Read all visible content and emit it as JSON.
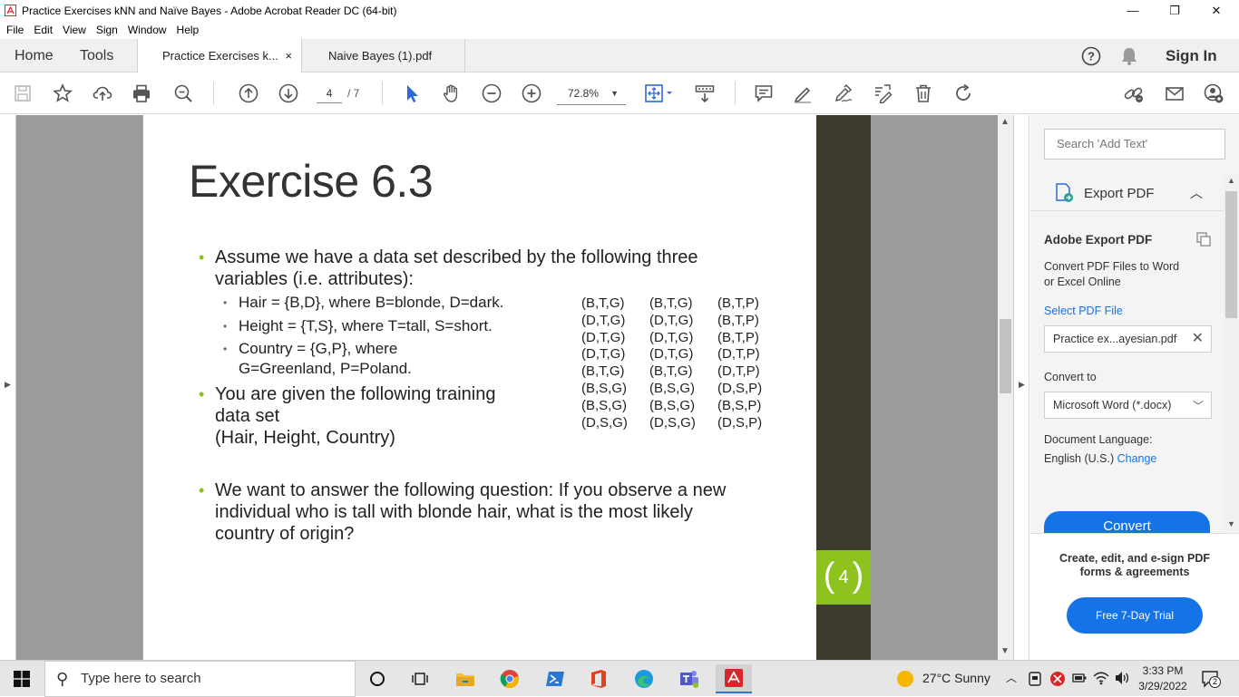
{
  "window": {
    "title": "Practice Exercises kNN and Naïve Bayes - Adobe Acrobat Reader DC (64-bit)",
    "minimize": "—",
    "restore": "❐",
    "close": "✕"
  },
  "menu": [
    "File",
    "Edit",
    "View",
    "Sign",
    "Window",
    "Help"
  ],
  "tabs": {
    "home": "Home",
    "tools": "Tools",
    "documents": [
      {
        "label": "Practice Exercises k...",
        "close": "×",
        "active": true
      },
      {
        "label": "Naive Bayes (1).pdf",
        "active": false
      }
    ],
    "help_icon": "?",
    "sign_in": "Sign In"
  },
  "toolbar": {
    "page_current": "4",
    "page_total": "/ 7",
    "zoom": "72.8%"
  },
  "slide": {
    "title": "Exercise 6.3",
    "bullet1": [
      "Assume we have a data set described by the following three",
      "variables (i.e. attributes):"
    ],
    "sub": [
      "Hair = {B,D}, where B=blonde, D=dark.",
      "Height = {T,S}, where T=tall, S=short.",
      "Country = {G,P}, where",
      "G=Greenland, P=Poland."
    ],
    "bullet2": [
      "You are given the following training",
      "data set",
      "(Hair, Height, Country)"
    ],
    "bullet3": [
      "We want to answer the following question: If you observe a new",
      "individual who is tall with blonde hair, what is the most likely",
      "country of origin?"
    ],
    "table": [
      [
        "(B,T,G)",
        "(B,T,G)",
        "(B,T,P)"
      ],
      [
        "(D,T,G)",
        "(D,T,G)",
        "(B,T,P)"
      ],
      [
        "(D,T,G)",
        "(D,T,G)",
        "(B,T,P)"
      ],
      [
        "(D,T,G)",
        "(D,T,G)",
        "(D,T,P)"
      ],
      [
        "(B,T,G)",
        "(B,T,G)",
        "(D,T,P)"
      ],
      [
        "(B,S,G)",
        "(B,S,G)",
        "(D,S,P)"
      ],
      [
        "(B,S,G)",
        "(B,S,G)",
        "(B,S,P)"
      ],
      [
        "(D,S,G)",
        "(D,S,G)",
        "(D,S,P)"
      ]
    ],
    "page_number": "4",
    "accent_color": "#8dc21f"
  },
  "right_pane": {
    "search_placeholder": "Search 'Add Text'",
    "export_label": "Export PDF",
    "heading": "Adobe Export PDF",
    "description": [
      "Convert PDF Files to Word",
      "or Excel Online"
    ],
    "select_file": "Select PDF File",
    "file_name": "Practice ex...ayesian.pdf",
    "convert_to": "Convert to",
    "format": "Microsoft Word (*.docx)",
    "doc_language": "Document Language:",
    "language": "English (U.S.)",
    "change": "Change",
    "convert": "Convert",
    "promo": [
      "Create, edit, and e-sign PDF",
      "forms & agreements"
    ],
    "trial": "Free 7-Day Trial"
  },
  "taskbar": {
    "search": "Type here to search",
    "weather": "27°C  Sunny",
    "time": "3:33 PM",
    "date": "3/29/2022",
    "notifications": "2"
  }
}
